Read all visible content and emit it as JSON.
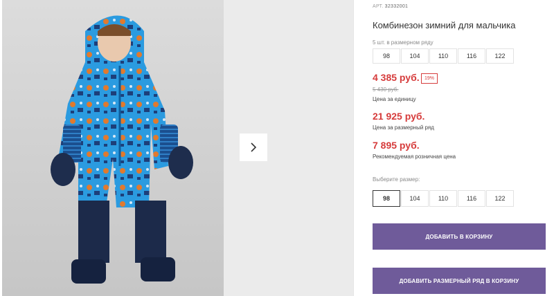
{
  "product": {
    "article_prefix": "АРТ.",
    "article": "32332001",
    "title": "Комбинезон зимний для мальчика",
    "row_label": "5 шт. в размерном ряду",
    "row_sizes": [
      "98",
      "104",
      "110",
      "116",
      "122"
    ],
    "price": "4 385 руб.",
    "discount": "19%",
    "old_price": "5 430 руб.",
    "price_note": "Цена за единицу",
    "row_price": "21 925 руб.",
    "row_price_note": "Цена за размерный ряд",
    "retail_price": "7 895 руб.",
    "retail_note": "Рекомендуемая розничная цена",
    "choose_label": "Выберите размер:",
    "choose_sizes": [
      "98",
      "104",
      "110",
      "116",
      "122"
    ],
    "selected_size": "98",
    "add_to_cart": "ДОБАВИТЬ В КОРЗИНУ",
    "add_row_to_cart": "ДОБАВИТЬ РАЗМЕРНЫЙ РЯД В КОРЗИНУ"
  },
  "gallery": {
    "next_icon": "chevron-right-icon"
  },
  "colors": {
    "accent": "#6f5b9a",
    "price": "#d63b3b"
  }
}
